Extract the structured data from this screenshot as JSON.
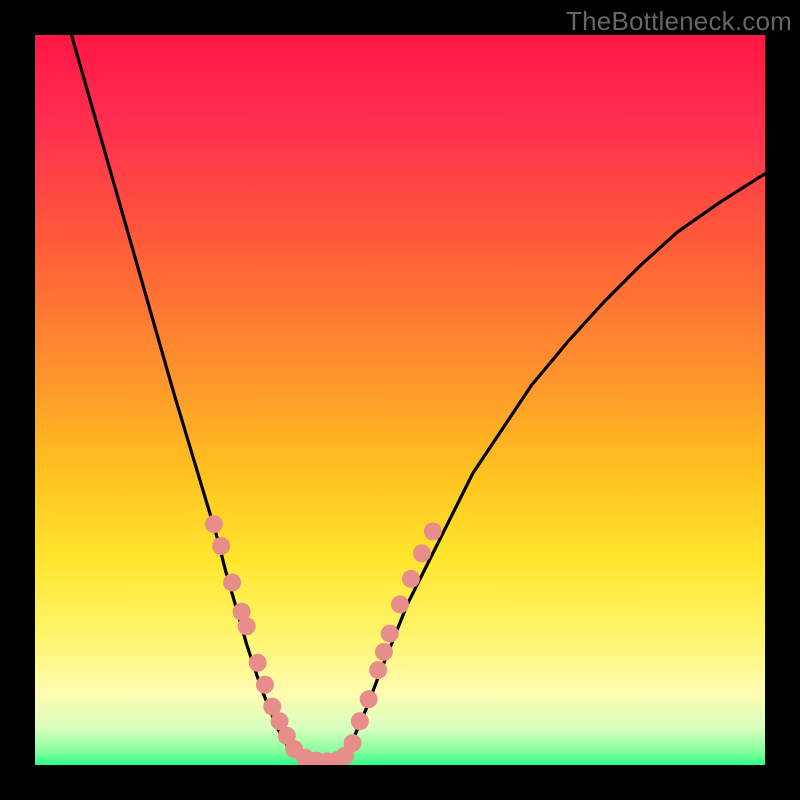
{
  "watermark": {
    "text": "TheBottleneck.com"
  },
  "chart_data": {
    "type": "line",
    "title": "",
    "xlabel": "",
    "ylabel": "",
    "xlim": [
      0,
      100
    ],
    "ylim": [
      0,
      100
    ],
    "background_gradient_stops": [
      {
        "offset": 0,
        "color": "#ff1744"
      },
      {
        "offset": 12,
        "color": "#ff2e4f"
      },
      {
        "offset": 28,
        "color": "#ff5a3a"
      },
      {
        "offset": 45,
        "color": "#ff8f2e"
      },
      {
        "offset": 60,
        "color": "#ffc21f"
      },
      {
        "offset": 72,
        "color": "#ffe62e"
      },
      {
        "offset": 82,
        "color": "#fff56b"
      },
      {
        "offset": 90,
        "color": "#fffbb0"
      },
      {
        "offset": 95,
        "color": "#d8ffbf"
      },
      {
        "offset": 98,
        "color": "#8cff9f"
      },
      {
        "offset": 100,
        "color": "#2cff89"
      }
    ],
    "series": [
      {
        "name": "left-curve",
        "x": [
          5,
          7,
          9,
          11,
          13,
          15,
          17,
          19,
          20.5,
          22,
          23.5,
          25,
          26,
          27,
          28,
          29,
          30,
          31,
          32,
          33,
          34,
          35,
          36,
          37
        ],
        "y": [
          100,
          93,
          86,
          79,
          72,
          65,
          58,
          51,
          46,
          41,
          36,
          31,
          27,
          23.5,
          20,
          16.5,
          13.5,
          10.5,
          8,
          5.5,
          3.5,
          2,
          1,
          0.5
        ]
      },
      {
        "name": "valley-floor",
        "x": [
          37,
          38,
          39,
          40,
          41,
          42
        ],
        "y": [
          0.5,
          0.3,
          0.25,
          0.25,
          0.3,
          0.5
        ]
      },
      {
        "name": "right-curve",
        "x": [
          42,
          43,
          44,
          45.5,
          47,
          49,
          51,
          54,
          57,
          60,
          64,
          68,
          73,
          78,
          83,
          88,
          94,
          100
        ],
        "y": [
          0.5,
          2,
          4.5,
          8,
          12,
          17,
          22,
          28,
          34,
          40,
          46,
          52,
          58,
          63.5,
          68.5,
          73,
          77.2,
          81
        ]
      }
    ],
    "dot_series": {
      "name": "highlight-dots",
      "color": "#e78d8a",
      "radius": 9,
      "points": [
        {
          "x": 24.5,
          "y": 33
        },
        {
          "x": 25.5,
          "y": 30
        },
        {
          "x": 27,
          "y": 25
        },
        {
          "x": 28.3,
          "y": 21
        },
        {
          "x": 29,
          "y": 19
        },
        {
          "x": 30.5,
          "y": 14
        },
        {
          "x": 31.5,
          "y": 11
        },
        {
          "x": 32.5,
          "y": 8
        },
        {
          "x": 33.5,
          "y": 6
        },
        {
          "x": 34.5,
          "y": 4
        },
        {
          "x": 35.5,
          "y": 2.2
        },
        {
          "x": 37,
          "y": 1
        },
        {
          "x": 38.5,
          "y": 0.6
        },
        {
          "x": 40,
          "y": 0.5
        },
        {
          "x": 41.5,
          "y": 0.7
        },
        {
          "x": 42.5,
          "y": 1.3
        },
        {
          "x": 43.5,
          "y": 3
        },
        {
          "x": 44.5,
          "y": 6
        },
        {
          "x": 45.7,
          "y": 9
        },
        {
          "x": 47,
          "y": 13
        },
        {
          "x": 47.8,
          "y": 15.5
        },
        {
          "x": 48.6,
          "y": 18
        },
        {
          "x": 50,
          "y": 22
        },
        {
          "x": 51.5,
          "y": 25.5
        },
        {
          "x": 53,
          "y": 29
        },
        {
          "x": 54.5,
          "y": 32
        }
      ]
    }
  }
}
